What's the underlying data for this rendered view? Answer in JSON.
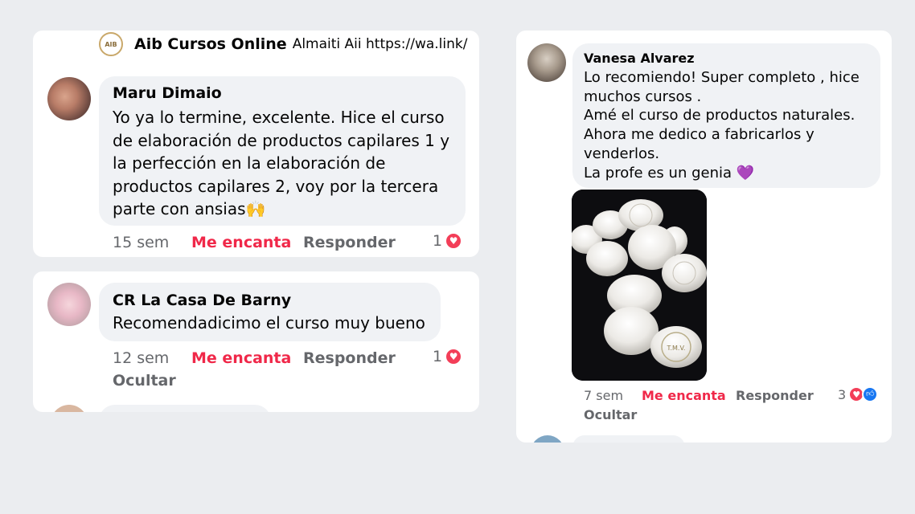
{
  "colors": {
    "background": "#ebedf0",
    "bubble": "#f0f2f5",
    "love": "#f02849",
    "muted": "#65676b"
  },
  "top_comment": {
    "name": "Aib Cursos Online",
    "text": "Almaiti Aii https://wa.link/n…",
    "logo_text": "AIB"
  },
  "comment1": {
    "name": "Maru Dimaio",
    "lines": [
      "Yo ya lo termine, excelente. Hice el curso",
      "de elaboración de productos capilares 1 y",
      "la perfección en la elaboración de",
      "productos capilares 2, voy por la tercera",
      "parte con ansias🙌"
    ],
    "time": "15 sem",
    "love": "Me encanta",
    "reply": "Responder",
    "reactions": "1",
    "reaction_icon": "heart-icon"
  },
  "comment2": {
    "name": "CR La Casa De Barny",
    "text": "Recomendadicimo el curso muy bueno",
    "time": "12 sem",
    "love": "Me encanta",
    "reply": "Responder",
    "reactions": "1",
    "hide": "Ocultar",
    "reaction_icon": "heart-icon"
  },
  "comment3": {
    "name": "Vanesa Alvarez",
    "lines": [
      "Lo recomiendo! Super completo , hice",
      "muchos cursos .",
      "Amé el curso de productos naturales.",
      "Ahora me dedico a fabricarlos y",
      "venderlos.",
      "La profe es un genia 💜"
    ],
    "photo_label": "T.M.V.",
    "time": "7 sem",
    "love": "Me encanta",
    "reply": "Responder",
    "reactions": "3",
    "hide": "Ocultar",
    "reaction_icons": [
      "heart-icon",
      "like-icon"
    ]
  }
}
